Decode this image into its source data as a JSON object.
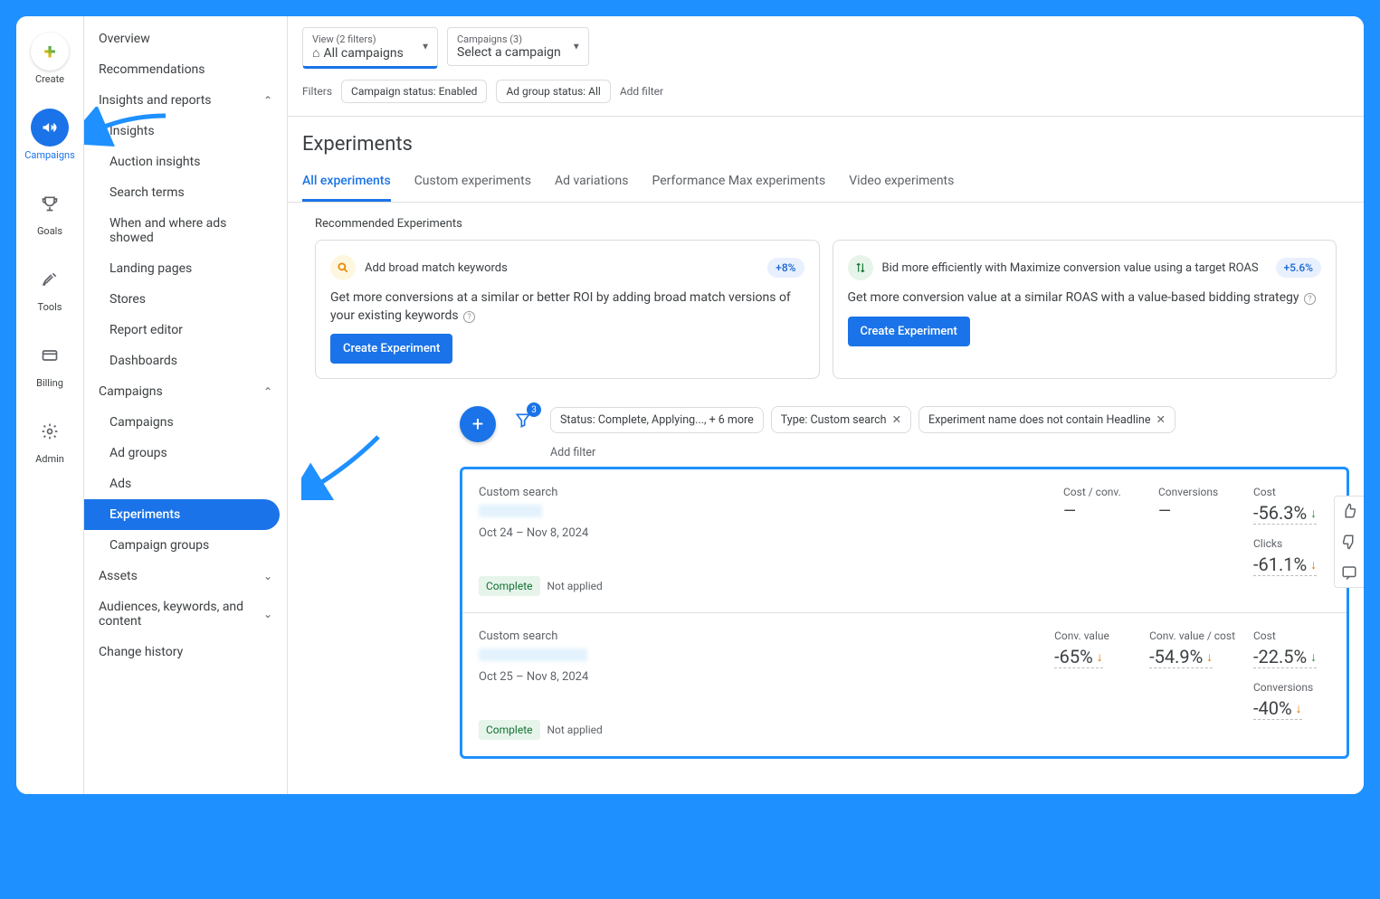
{
  "rail": {
    "create": "Create",
    "campaigns": "Campaigns",
    "goals": "Goals",
    "tools": "Tools",
    "billing": "Billing",
    "admin": "Admin"
  },
  "sidebar": {
    "overview": "Overview",
    "recommendations": "Recommendations",
    "insights_section": "Insights and reports",
    "insights": "Insights",
    "auction": "Auction insights",
    "search_terms": "Search terms",
    "when_where": "When and where ads showed",
    "landing": "Landing pages",
    "stores": "Stores",
    "report_editor": "Report editor",
    "dashboards": "Dashboards",
    "campaigns_section": "Campaigns",
    "campaigns": "Campaigns",
    "ad_groups": "Ad groups",
    "ads": "Ads",
    "experiments": "Experiments",
    "campaign_groups": "Campaign groups",
    "assets": "Assets",
    "audiences": "Audiences, keywords, and content",
    "change_history": "Change history"
  },
  "topbar": {
    "view_small": "View (2 filters)",
    "view_big": "All campaigns",
    "camp_small": "Campaigns (3)",
    "camp_big": "Select a campaign"
  },
  "filters": {
    "label": "Filters",
    "chip1": "Campaign status: Enabled",
    "chip2": "Ad group status: All",
    "add": "Add filter"
  },
  "page_title": "Experiments",
  "tabs": {
    "t1": "All experiments",
    "t2": "Custom experiments",
    "t3": "Ad variations",
    "t4": "Performance Max experiments",
    "t5": "Video experiments"
  },
  "reco": {
    "title": "Recommended Experiments",
    "card1_title": "Add broad match keywords",
    "card1_badge": "+8%",
    "card1_desc": "Get more conversions at a similar or better ROI by adding broad match versions of your existing keywords",
    "card2_title": "Bid more efficiently with Maximize conversion value using a target ROAS",
    "card2_badge": "+5.6%",
    "card2_desc": "Get more conversion value at a similar ROAS with a value-based bidding strategy",
    "btn": "Create Experiment"
  },
  "exp_toolbar": {
    "funnel_count": "3",
    "chip1": "Status: Complete, Applying..., + 6 more",
    "chip2": "Type: Custom search",
    "chip3": "Experiment name does not contain Headline",
    "add": "Add filter"
  },
  "results": [
    {
      "type": "Custom search",
      "date": "Oct 24 – Nov 8, 2024",
      "status": "Complete",
      "applied": "Not applied",
      "metrics_top": [
        {
          "label": "Cost / conv.",
          "value": "—"
        },
        {
          "label": "Conversions",
          "value": "—"
        }
      ],
      "metrics_right": [
        {
          "label": "Cost",
          "value": "-56.3%",
          "dir": "down-good"
        },
        {
          "label": "Clicks",
          "value": "-61.1%",
          "dir": "down-bad"
        }
      ]
    },
    {
      "type": "Custom search",
      "date": "Oct 25 – Nov 8, 2024",
      "status": "Complete",
      "applied": "Not applied",
      "metrics_top": [
        {
          "label": "Conv. value",
          "value": "-65%",
          "dir": "down-bad"
        },
        {
          "label": "Conv. value / cost",
          "value": "-54.9%",
          "dir": "down-bad"
        }
      ],
      "metrics_right": [
        {
          "label": "Cost",
          "value": "-22.5%",
          "dir": "down-good"
        },
        {
          "label": "Conversions",
          "value": "-40%",
          "dir": "down-bad"
        }
      ]
    }
  ]
}
